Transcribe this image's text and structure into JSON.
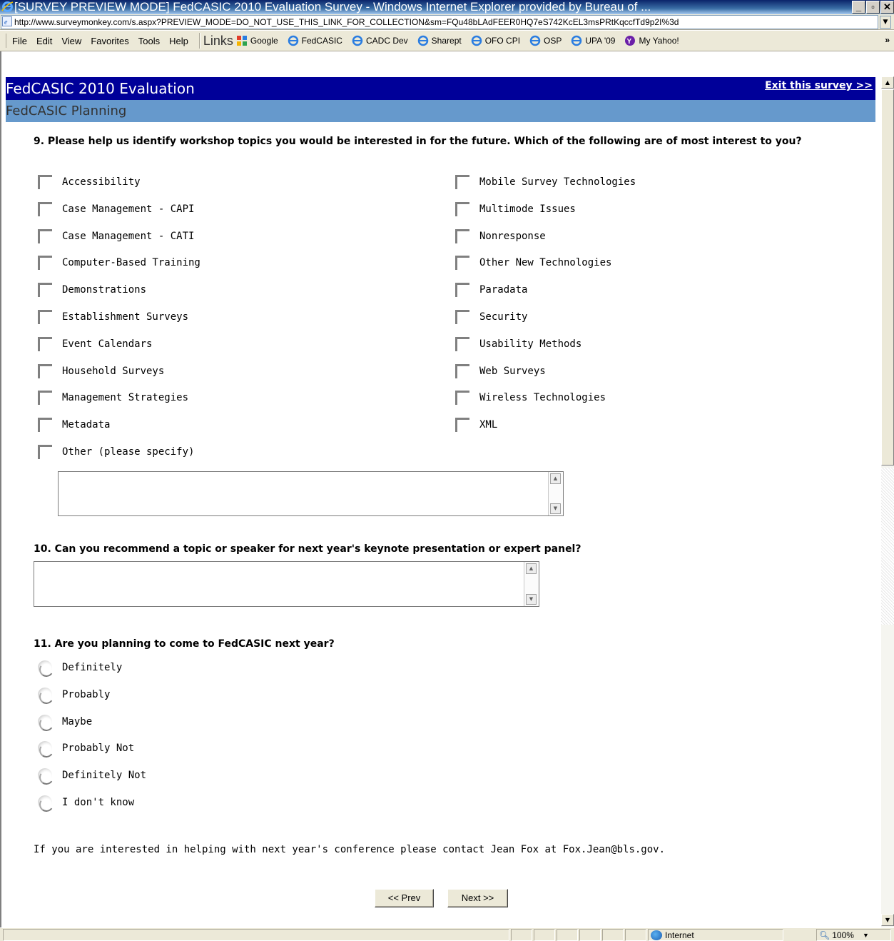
{
  "window": {
    "title": "[SURVEY PREVIEW MODE] FedCASIC 2010 Evaluation Survey - Windows Internet Explorer provided by Bureau of ...",
    "minimize": "_",
    "maximize": "▫",
    "close": "✕"
  },
  "address": {
    "url": "http://www.surveymonkey.com/s.aspx?PREVIEW_MODE=DO_NOT_USE_THIS_LINK_FOR_COLLECTION&sm=FQu48bLAdFEER0HQ7eS742KcEL3msPRtKqccfTd9p2I%3d"
  },
  "menu": {
    "items": [
      "File",
      "Edit",
      "View",
      "Favorites",
      "Tools",
      "Help"
    ],
    "links_label": "Links",
    "links": [
      "Google",
      "FedCASIC",
      "CADC Dev",
      "Sharept",
      "OFO CPI",
      "OSP",
      "UPA '09",
      "My Yahoo!"
    ],
    "more": "»"
  },
  "survey": {
    "title": "FedCASIC 2010 Evaluation",
    "exit_link": "Exit this survey >>",
    "section": "FedCASIC Planning"
  },
  "q9": {
    "text": "9. Please help us identify workshop topics you would be interested in for the future. Which of the following are of most interest to you?",
    "left_options": [
      "Accessibility",
      "Case Management - CAPI",
      "Case Management - CATI",
      "Computer-Based Training",
      "Demonstrations",
      "Establishment Surveys",
      "Event Calendars",
      "Household Surveys",
      "Management Strategies",
      "Metadata",
      "Other (please specify)"
    ],
    "right_options": [
      "Mobile Survey Technologies",
      "Multimode Issues",
      "Nonresponse",
      "Other New Technologies",
      "Paradata",
      "Security",
      "Usability Methods",
      "Web Surveys",
      "Wireless Technologies",
      "XML"
    ]
  },
  "q10": {
    "text": "10. Can you recommend a topic or speaker for next year's keynote presentation or expert panel?"
  },
  "q11": {
    "text": "11. Are you planning to come to FedCASIC next year?",
    "options": [
      "Definitely",
      "Probably",
      "Maybe",
      "Probably Not",
      "Definitely Not",
      "I don't know"
    ]
  },
  "contact_note": "If you are interested in helping with next year's conference please contact Jean Fox at Fox.Jean@bls.gov.",
  "nav": {
    "prev": "<< Prev",
    "next": "Next >>"
  },
  "status": {
    "zone": "Internet",
    "zoom": "100%"
  },
  "colors": {
    "survey_header": "#000099",
    "section_bar": "#6699cc"
  }
}
